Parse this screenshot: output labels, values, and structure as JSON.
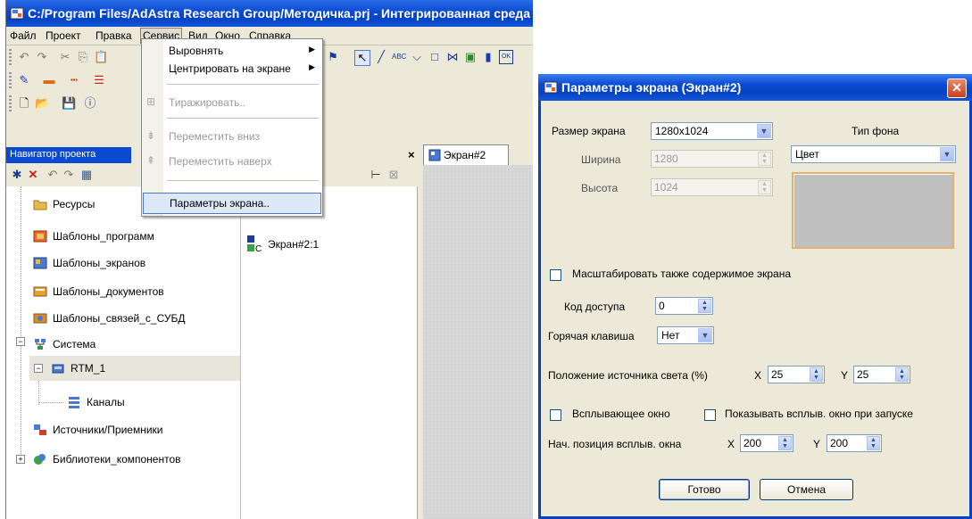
{
  "app": {
    "title": "C:/Program Files/AdAstra Research Group/Методичка.prj - Интегрированная среда",
    "menu": [
      "Файл",
      "Проект",
      "Правка",
      "Сервис",
      "Вид",
      "Окно",
      "Справка"
    ],
    "active_menu": "Сервис",
    "navigator_title": "Навигатор проекта",
    "navigator_close": "×",
    "screen_tab": "Экран#2",
    "screen_item": "Экран#2:1",
    "screen_item_prefix": "C"
  },
  "dropdown": {
    "items": [
      {
        "label": "Выровнять",
        "submenu": true,
        "disabled": false
      },
      {
        "label": "Центрировать на экране",
        "submenu": true,
        "disabled": false
      },
      {
        "label": "Тиражировать..",
        "submenu": false,
        "disabled": true
      },
      {
        "label": "Переместить вниз",
        "submenu": false,
        "disabled": true
      },
      {
        "label": "Переместить наверх",
        "submenu": false,
        "disabled": true
      },
      {
        "label": "Параметры экрана..",
        "submenu": false,
        "disabled": false,
        "highlighted": true
      }
    ]
  },
  "tree": [
    {
      "label": "Ресурсы",
      "icon": "folder-icon"
    },
    {
      "label": "Шаблоны_программ",
      "icon": "template-program-icon"
    },
    {
      "label": "Шаблоны_экранов",
      "icon": "template-screen-icon"
    },
    {
      "label": "Шаблоны_документов",
      "icon": "template-document-icon"
    },
    {
      "label": "Шаблоны_связей_с_СУБД",
      "icon": "template-db-icon"
    },
    {
      "label": "Система",
      "icon": "system-icon"
    },
    {
      "label": "RTM_1",
      "icon": "rtm-icon"
    },
    {
      "label": "Каналы",
      "icon": "channels-icon"
    },
    {
      "label": "Источники/Приемники",
      "icon": "sources-icon"
    },
    {
      "label": "Библиотеки_компонентов",
      "icon": "library-icon"
    }
  ],
  "dialog": {
    "title": "Параметры экрана (Экран#2)",
    "close": "✕",
    "size_label": "Размер экрана",
    "size_value": "1280x1024",
    "bg_type_label": "Тип фона",
    "bg_type_value": "Цвет",
    "width_label": "Ширина",
    "width_value": "1280",
    "height_label": "Высота",
    "height_value": "1024",
    "scale_label": "Масштабировать также содержимое экрана",
    "access_label": "Код доступа",
    "access_value": "0",
    "hotkey_label": "Горячая клавиша",
    "hotkey_value": "Нет",
    "light_label": "Положение источника света (%)",
    "light_x_label": "X",
    "light_x_value": "25",
    "light_y_label": "Y",
    "light_y_value": "25",
    "popup_label": "Всплывающее окно",
    "show_popup_label": "Показывать всплыв. окно при запуске",
    "popup_pos_label": "Нач. позиция всплыв. окна",
    "popup_x_label": "X",
    "popup_x_value": "200",
    "popup_y_label": "Y",
    "popup_y_value": "200",
    "ok_label": "Готово",
    "cancel_label": "Отмена",
    "preview_color": "#c0c0c0"
  }
}
